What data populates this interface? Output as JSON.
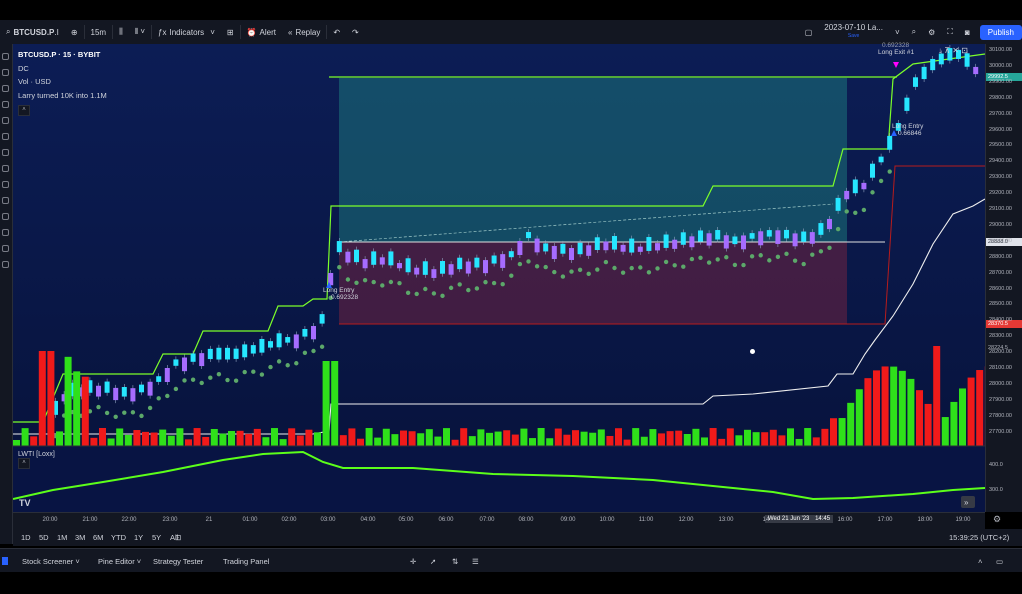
{
  "toolbar": {
    "symbol": "BTCUSD.P",
    "interval": "15m",
    "indicators": "Indicators",
    "alert": "Alert",
    "replay": "Replay",
    "layout_name": "2023-07-10 La...",
    "layout_sub": "Save",
    "publish": "Publish"
  },
  "legend": {
    "title": "BTCUSD.P · 15 · BYBIT",
    "line2": "DC",
    "line3": "Vol · USD",
    "line4": "Larry turned 10K into 1.1M"
  },
  "lwti": {
    "label": "LWTI [Loxx]",
    "scale_high": "400.0",
    "scale_low": "300.0"
  },
  "annotations": {
    "entry1": "Long Entry",
    "entry1_val": "0.692328",
    "entry2": "Long Entry",
    "entry2_val": "0.66846",
    "exit1": "Long Exit #1",
    "exit1_val": "0.692328"
  },
  "price_axis": {
    "labels": [
      "30100.00",
      "30000.00",
      "29900.00",
      "29800.00",
      "29700.00",
      "29600.00",
      "29500.00",
      "29400.00",
      "29300.00",
      "29200.00",
      "29100.00",
      "29000.00",
      "28900.00",
      "28800.00",
      "28700.00",
      "28600.00",
      "28500.00",
      "28400.00",
      "28300.00",
      "28200.00",
      "28100.00",
      "28000.00",
      "27900.00",
      "27800.00",
      "27700.00"
    ],
    "tag_green": "29992.5",
    "tag_white": "28888.0",
    "tag_red": "28370.5",
    "tag_dark": "28224.5",
    "colors": {
      "green": "#26a69a",
      "red": "#e53935",
      "accent": "#2962ff"
    }
  },
  "time_axis": {
    "labels": [
      "20:00",
      "21:00",
      "22:00",
      "23:00",
      "21",
      "01:00",
      "02:00",
      "03:00",
      "04:00",
      "05:00",
      "06:00",
      "07:00",
      "08:00",
      "09:00",
      "10:00",
      "11:00",
      "12:00",
      "13:00",
      "14",
      "16:00",
      "17:00",
      "18:00",
      "19:00"
    ],
    "cursor_label": "Wed 21 Jun '23",
    "cursor_time": "14:45"
  },
  "range_bar": {
    "ranges": [
      "1D",
      "5D",
      "1M",
      "3M",
      "6M",
      "YTD",
      "1Y",
      "5Y",
      "All"
    ],
    "clock": "15:39:25 (UTC+2)"
  },
  "bottom_panel": {
    "tabs": [
      "Stock Screener",
      "Pine Editor",
      "Strategy Tester",
      "Trading Panel"
    ]
  }
}
